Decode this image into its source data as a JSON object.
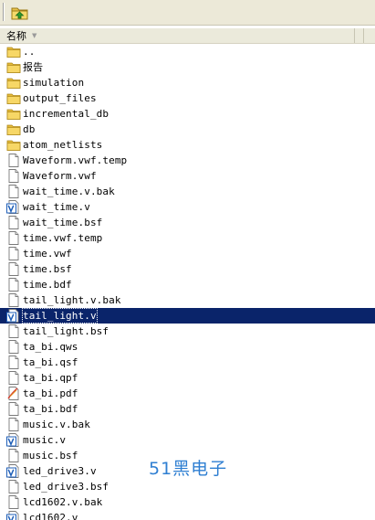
{
  "header": {
    "name_column": "名称"
  },
  "files": [
    {
      "label": "..",
      "icon": "folder-icon"
    },
    {
      "label": "报告",
      "icon": "folder-icon"
    },
    {
      "label": "simulation",
      "icon": "folder-icon"
    },
    {
      "label": "output_files",
      "icon": "folder-icon"
    },
    {
      "label": "incremental_db",
      "icon": "folder-icon"
    },
    {
      "label": "db",
      "icon": "folder-icon"
    },
    {
      "label": "atom_netlists",
      "icon": "folder-icon"
    },
    {
      "label": "Waveform.vwf.temp",
      "icon": "file-icon"
    },
    {
      "label": "Waveform.vwf",
      "icon": "file-icon"
    },
    {
      "label": "wait_time.v.bak",
      "icon": "file-icon"
    },
    {
      "label": "wait_time.v",
      "icon": "verilog-file-icon"
    },
    {
      "label": "wait_time.bsf",
      "icon": "file-icon"
    },
    {
      "label": "time.vwf.temp",
      "icon": "file-icon"
    },
    {
      "label": "time.vwf",
      "icon": "file-icon"
    },
    {
      "label": "time.bsf",
      "icon": "file-icon"
    },
    {
      "label": "time.bdf",
      "icon": "file-icon"
    },
    {
      "label": "tail_light.v.bak",
      "icon": "file-icon"
    },
    {
      "label": "tail_light.v",
      "icon": "verilog-file-icon",
      "selected": true
    },
    {
      "label": "tail_light.bsf",
      "icon": "file-icon"
    },
    {
      "label": "ta_bi.qws",
      "icon": "file-icon"
    },
    {
      "label": "ta_bi.qsf",
      "icon": "file-icon"
    },
    {
      "label": "ta_bi.qpf",
      "icon": "file-icon"
    },
    {
      "label": "ta_bi.pdf",
      "icon": "pdf-file-icon"
    },
    {
      "label": "ta_bi.bdf",
      "icon": "file-icon"
    },
    {
      "label": "music.v.bak",
      "icon": "file-icon"
    },
    {
      "label": "music.v",
      "icon": "verilog-file-icon"
    },
    {
      "label": "music.bsf",
      "icon": "file-icon"
    },
    {
      "label": "led_drive3.v",
      "icon": "verilog-file-icon"
    },
    {
      "label": "led_drive3.bsf",
      "icon": "file-icon"
    },
    {
      "label": "lcd1602.v.bak",
      "icon": "file-icon"
    },
    {
      "label": "lcd1602.v",
      "icon": "verilog-file-icon"
    }
  ],
  "watermark": "51黑电子",
  "colors": {
    "selection": "#0a246a",
    "folder": "#f2c94c",
    "verilog": "#1f5fb8",
    "watermark": "#2f7fd2"
  }
}
